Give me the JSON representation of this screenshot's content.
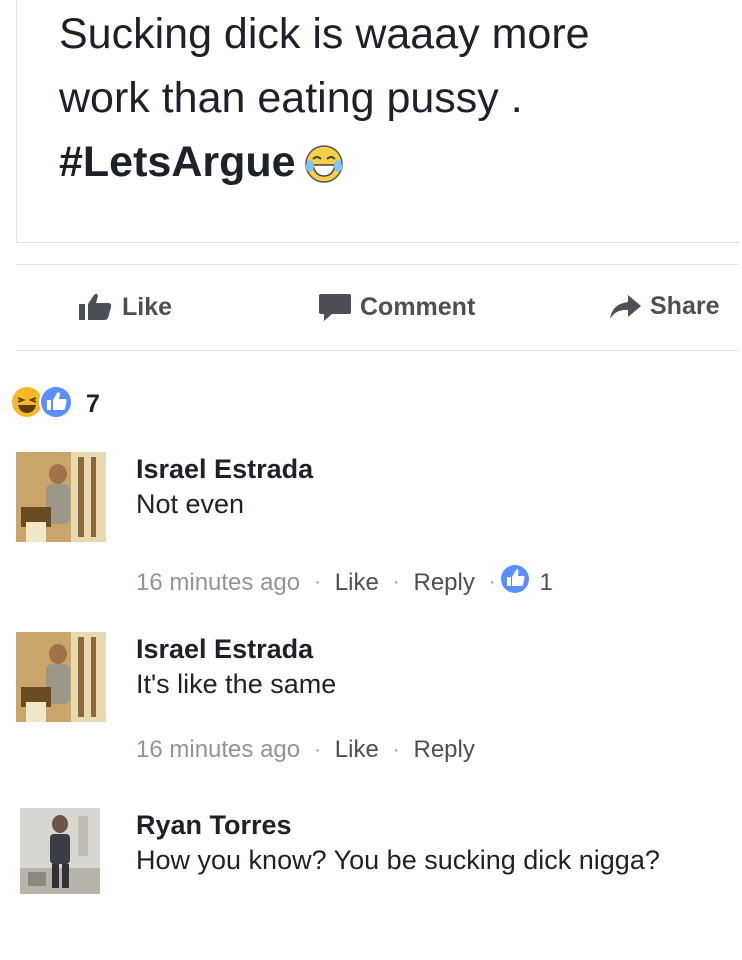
{
  "post": {
    "line1": "Sucking dick is waaay more",
    "line2": "work than eating pussy .",
    "hashtag": "#LetsArgue"
  },
  "actions": {
    "like_label": "Like",
    "comment_label": "Comment",
    "share_label": "Share"
  },
  "reactions": {
    "count": "7",
    "types": [
      "haha-icon",
      "like-icon"
    ]
  },
  "comments": [
    {
      "name": "Israel Estrada",
      "text": "Not even",
      "time": "16 minutes ago",
      "like_label": "Like",
      "reply_label": "Reply",
      "like_count": "1"
    },
    {
      "name": "Israel Estrada",
      "text": "It's like the same",
      "time": "16 minutes ago",
      "like_label": "Like",
      "reply_label": "Reply"
    },
    {
      "name": "Ryan Torres",
      "text": "How you know? You be sucking dick nigga?"
    }
  ],
  "colors": {
    "text_primary": "#1d2129",
    "text_secondary": "#90949c",
    "action_gray": "#4b4f56",
    "like_blue": "#5890ff",
    "haha_yellow": "#f7b928"
  }
}
